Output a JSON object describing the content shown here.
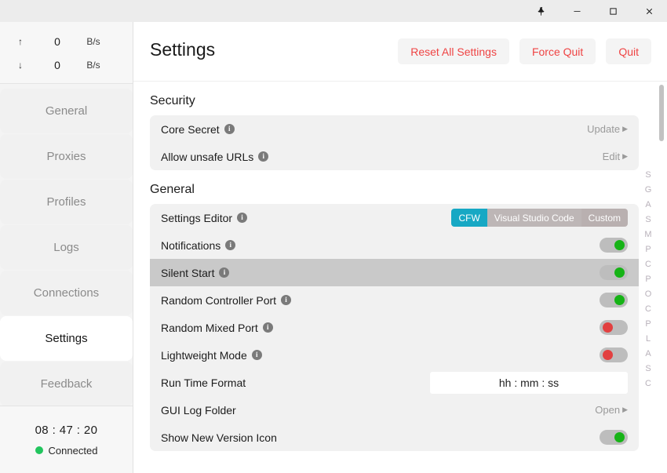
{
  "titlebar": {
    "buttons": [
      {
        "name": "pin-icon",
        "label": "⤒"
      },
      {
        "name": "minimize-icon",
        "label": "–"
      },
      {
        "name": "maximize-icon",
        "label": "□"
      },
      {
        "name": "close-icon",
        "label": "✕"
      }
    ]
  },
  "sidebar": {
    "traffic": [
      {
        "arrow": "↑",
        "value": "0",
        "unit": "B/s"
      },
      {
        "arrow": "↓",
        "value": "0",
        "unit": "B/s"
      }
    ],
    "items": [
      {
        "label": "General",
        "active": false
      },
      {
        "label": "Proxies",
        "active": false
      },
      {
        "label": "Profiles",
        "active": false
      },
      {
        "label": "Logs",
        "active": false
      },
      {
        "label": "Connections",
        "active": false
      },
      {
        "label": "Settings",
        "active": true
      },
      {
        "label": "Feedback",
        "active": false
      }
    ],
    "status": {
      "clock": "08 : 47 : 20",
      "connection": "Connected",
      "connection_color": "#22c55e"
    }
  },
  "header": {
    "title": "Settings",
    "actions": [
      {
        "label": "Reset All Settings"
      },
      {
        "label": "Force Quit"
      },
      {
        "label": "Quit"
      }
    ],
    "action_color": "#ef4444"
  },
  "sections": [
    {
      "title": "Security",
      "rows": [
        {
          "label": "Core Secret",
          "info": true,
          "control": "link",
          "action": "Update",
          "hover": false
        },
        {
          "label": "Allow unsafe URLs",
          "info": true,
          "control": "link",
          "action": "Edit",
          "hover": false
        }
      ]
    },
    {
      "title": "General",
      "rows": [
        {
          "label": "Settings Editor",
          "info": true,
          "control": "segmented",
          "hover": false,
          "options": [
            "CFW",
            "Visual Studio Code",
            "Custom"
          ],
          "selected": "CFW",
          "selected_color": "#17a8c4"
        },
        {
          "label": "Notifications",
          "info": true,
          "control": "toggle",
          "state": "on",
          "hover": false
        },
        {
          "label": "Silent Start",
          "info": true,
          "control": "toggle",
          "state": "on",
          "hover": true
        },
        {
          "label": "Random Controller Port",
          "info": true,
          "control": "toggle",
          "state": "on",
          "hover": false
        },
        {
          "label": "Random Mixed Port",
          "info": true,
          "control": "toggle",
          "state": "off",
          "hover": false
        },
        {
          "label": "Lightweight Mode",
          "info": true,
          "control": "toggle",
          "state": "off",
          "hover": false
        },
        {
          "label": "Run Time Format",
          "info": false,
          "control": "input",
          "value": "hh : mm : ss",
          "placeholder": "hh : mm : ss",
          "hover": false
        },
        {
          "label": "GUI Log Folder",
          "info": false,
          "control": "link",
          "action": "Open",
          "hover": false
        },
        {
          "label": "Show New Version Icon",
          "info": false,
          "control": "toggle",
          "state": "on",
          "hover": false
        }
      ]
    }
  ],
  "index_rail": {
    "letters": [
      "S",
      "G",
      "A",
      "S",
      "M",
      "P",
      "C",
      "P",
      "O",
      "C",
      "P",
      "L",
      "A",
      "S",
      "C"
    ]
  },
  "toggle_colors": {
    "on": "#16b316",
    "off": "#e24040",
    "track": "#bdbdbd"
  }
}
